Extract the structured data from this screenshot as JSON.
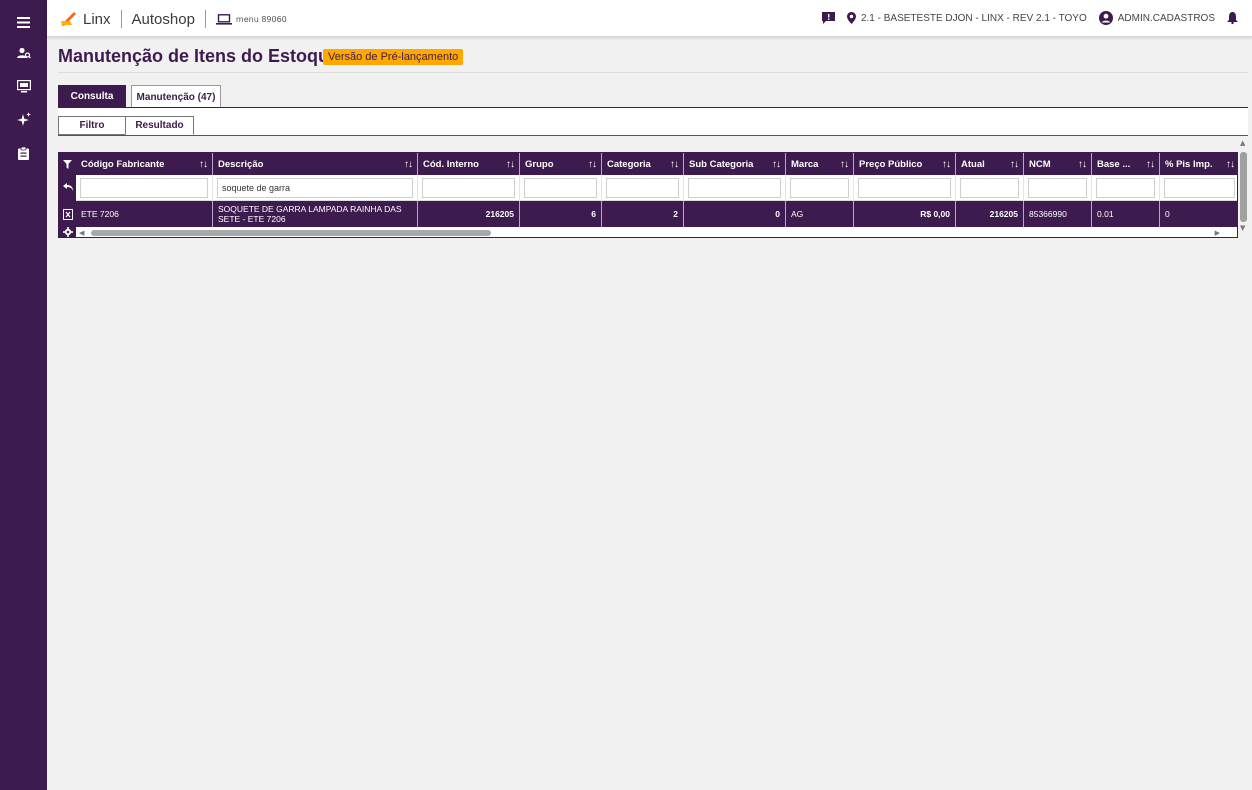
{
  "sidebar": {
    "icons": [
      "hamburger-menu-icon",
      "user-search-icon",
      "monitor-icon",
      "sparkles-icon",
      "clipboard-icon"
    ]
  },
  "topbar": {
    "brand": "Linx",
    "product": "Autoshop",
    "menu_code": "menu 89060",
    "environment": "2.1 - BASETESTE DJON - LINX - REV 2.1 - TOYO",
    "user": "ADMIN.CADASTROS"
  },
  "page": {
    "title": "Manutenção de Itens do Estoque",
    "badge": "Versão de Pré-lançamento"
  },
  "tabs": [
    "Consulta",
    "Manutenção (47)"
  ],
  "subtabs": [
    "Filtro",
    "Resultado"
  ],
  "grid": {
    "columns": [
      "Código Fabricante",
      "Descrição",
      "Cód. Interno",
      "Grupo",
      "Categoria",
      "Sub Categoria",
      "Marca",
      "Preço Público",
      "Atual",
      "NCM",
      "Base ...",
      "% Pis Imp."
    ],
    "filters": [
      "",
      "soquete de garra",
      "",
      "",
      "",
      "",
      "",
      "",
      "",
      "",
      "",
      ""
    ],
    "rows": [
      [
        "ETE 7206",
        "SOQUETE DE GARRA LAMPADA RAINHA DAS SETE - ETE 7206",
        "216205",
        "6",
        "2",
        "0",
        "AG",
        "R$ 0,00",
        "216205",
        "85366990",
        "0.01",
        "0"
      ]
    ]
  },
  "colors": {
    "primary": "#3d1b4e",
    "accent": "#ffa800",
    "logo": "#f26c1b"
  }
}
